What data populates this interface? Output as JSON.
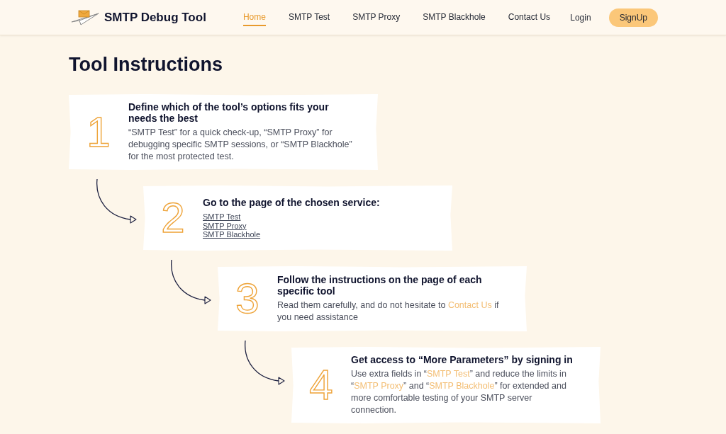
{
  "header": {
    "brand": "SMTP Debug Tool",
    "nav": [
      {
        "label": "Home",
        "selected": true
      },
      {
        "label": "SMTP Test",
        "selected": false
      },
      {
        "label": "SMTP Proxy",
        "selected": false
      },
      {
        "label": "SMTP Blackhole",
        "selected": false
      },
      {
        "label": "Contact Us",
        "selected": false
      }
    ],
    "login": "Login",
    "signup": "SignUp"
  },
  "title": "Tool Instructions",
  "steps": [
    {
      "number": "1",
      "title": "Define which of the tool’s options fits your needs the best",
      "kind": "paragraph",
      "description": [
        {
          "kind": "text",
          "text": "“SMTP Test” for a quick check-up, “SMTP Proxy” for debugging specific SMTP sessions, or “SMTP Blackhole” for the most protected test."
        }
      ]
    },
    {
      "number": "2",
      "title": "Go to the page of the chosen service:",
      "kind": "link_list",
      "links": [
        "SMTP Test",
        "SMTP Proxy",
        "SMTP Blackhole"
      ]
    },
    {
      "number": "3",
      "title": "Follow the instructions on the page of each specific tool",
      "kind": "paragraph",
      "description": [
        {
          "kind": "text",
          "text": "Read them carefully, and do not hesitate to "
        },
        {
          "kind": "link",
          "text": "Contact Us"
        },
        {
          "kind": "text",
          "text": " if you need assistance"
        }
      ]
    },
    {
      "number": "4",
      "title": "Get access to “More Parameters” by signing in",
      "kind": "paragraph",
      "description": [
        {
          "kind": "text",
          "text": "Use extra fields in “"
        },
        {
          "kind": "link",
          "text": "SMTP Test"
        },
        {
          "kind": "text",
          "text": "” and reduce the limits in “"
        },
        {
          "kind": "link",
          "text": "SMTP Proxy"
        },
        {
          "kind": "text",
          "text": "” and “"
        },
        {
          "kind": "link",
          "text": "SMTP Blackhole"
        },
        {
          "kind": "text",
          "text": "” for extended and more comfortable testing of your SMTP server connection."
        }
      ]
    }
  ]
}
